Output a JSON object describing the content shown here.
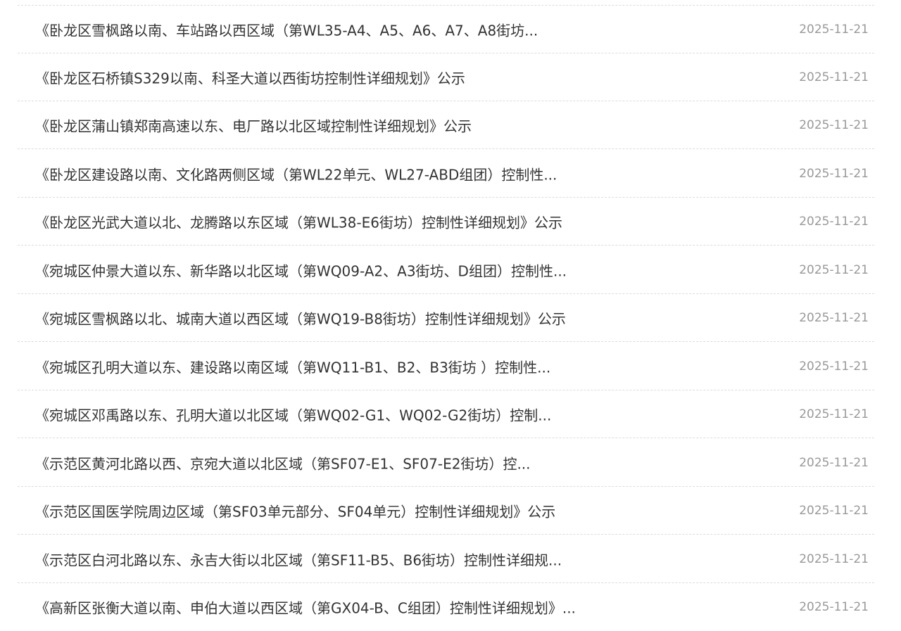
{
  "list": {
    "items": [
      {
        "title": "《卧龙区雪枫路以南、车站路以西区域（第WL35-A4、A5、A6、A7、A8街坊...",
        "date": "2025-11-21"
      },
      {
        "title": "《卧龙区石桥镇S329以南、科圣大道以西街坊控制性详细规划》公示",
        "date": "2025-11-21"
      },
      {
        "title": "《卧龙区蒲山镇郑南高速以东、电厂路以北区域控制性详细规划》公示",
        "date": "2025-11-21"
      },
      {
        "title": "《卧龙区建设路以南、文化路两侧区域（第WL22单元、WL27-ABD组团）控制性...",
        "date": "2025-11-21"
      },
      {
        "title": "《卧龙区光武大道以北、龙腾路以东区域（第WL38-E6街坊）控制性详细规划》公示",
        "date": "2025-11-21"
      },
      {
        "title": "《宛城区仲景大道以东、新华路以北区域（第WQ09-A2、A3街坊、D组团）控制性...",
        "date": "2025-11-21"
      },
      {
        "title": "《宛城区雪枫路以北、城南大道以西区域（第WQ19-B8街坊）控制性详细规划》公示",
        "date": "2025-11-21"
      },
      {
        "title": "《宛城区孔明大道以东、建设路以南区域（第WQ11-B1、B2、B3街坊 ）控制性...",
        "date": "2025-11-21"
      },
      {
        "title": "《宛城区邓禹路以东、孔明大道以北区域（第WQ02-G1、WQ02-G2街坊）控制...",
        "date": "2025-11-21"
      },
      {
        "title": "《示范区黄河北路以西、京宛大道以北区域（第SF07-E1、SF07-E2街坊）控...",
        "date": "2025-11-21"
      },
      {
        "title": "《示范区国医学院周边区域（第SF03单元部分、SF04单元）控制性详细规划》公示",
        "date": "2025-11-21"
      },
      {
        "title": "《示范区白河北路以东、永吉大街以北区域（第SF11-B5、B6街坊）控制性详细规...",
        "date": "2025-11-21"
      },
      {
        "title": "《高新区张衡大道以南、申伯大道以西区域（第GX04-B、C组团）控制性详细规划》...",
        "date": "2025-11-21"
      }
    ]
  }
}
